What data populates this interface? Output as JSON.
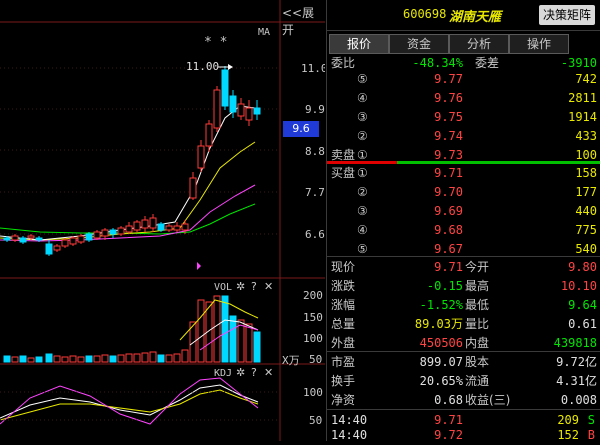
{
  "chart": {
    "expand_label": "<<展开",
    "ma_label": "MA",
    "peak_label": "11.00",
    "stars": "* *",
    "price_axis": [
      "11.0",
      "9.9",
      "8.8",
      "7.7",
      "6.6"
    ],
    "current_price_tag": "9.6",
    "vol_title": "VOL",
    "vol_axis": [
      "200",
      "150",
      "100",
      "50"
    ],
    "vol_unit": "X万",
    "kdj_title": "KDJ",
    "kdj_axis": [
      "100",
      "50"
    ],
    "colors": {
      "up": "#ff3a3a",
      "down": "#00d8ff",
      "ma5": "#ffffff",
      "ma10": "#e8e800",
      "ma20": "#ff44ff",
      "ma60": "#00e600"
    }
  },
  "header": {
    "code": "600698",
    "name": "湖南天雁",
    "decision_button": "决策矩阵"
  },
  "tabs": [
    {
      "label": "报价",
      "active": true
    },
    {
      "label": "资金",
      "active": false
    },
    {
      "label": "分析",
      "active": false
    },
    {
      "label": "操作",
      "active": false
    }
  ],
  "ratio": {
    "weibi_label": "委比",
    "weibi_value": "-48.34%",
    "weicha_label": "委差",
    "weicha_value": "-3910"
  },
  "sell_orders": [
    {
      "label": "",
      "level": "⑤",
      "price": "9.77",
      "volume": "742"
    },
    {
      "label": "",
      "level": "④",
      "price": "9.76",
      "volume": "2811"
    },
    {
      "label": "",
      "level": "③",
      "price": "9.75",
      "volume": "1914"
    },
    {
      "label": "",
      "level": "②",
      "price": "9.74",
      "volume": "433"
    },
    {
      "label": "卖盘",
      "level": "①",
      "price": "9.73",
      "volume": "100"
    }
  ],
  "buy_orders": [
    {
      "label": "买盘",
      "level": "①",
      "price": "9.71",
      "volume": "158"
    },
    {
      "label": "",
      "level": "②",
      "price": "9.70",
      "volume": "177"
    },
    {
      "label": "",
      "level": "③",
      "price": "9.69",
      "volume": "440"
    },
    {
      "label": "",
      "level": "④",
      "price": "9.68",
      "volume": "775"
    },
    {
      "label": "",
      "level": "⑤",
      "price": "9.67",
      "volume": "540"
    }
  ],
  "quote": [
    {
      "l1": "现价",
      "v1": "9.71",
      "c1": "red",
      "l2": "今开",
      "v2": "9.80",
      "c2": "red"
    },
    {
      "l1": "涨跌",
      "v1": "-0.15",
      "c1": "green",
      "l2": "最高",
      "v2": "10.10",
      "c2": "red"
    },
    {
      "l1": "涨幅",
      "v1": "-1.52%",
      "c1": "green",
      "l2": "最低",
      "v2": "9.64",
      "c2": "green"
    },
    {
      "l1": "总量",
      "v1": "89.03万",
      "c1": "yellow",
      "l2": "量比",
      "v2": "0.61",
      "c2": "white"
    },
    {
      "l1": "外盘",
      "v1": "450506",
      "c1": "red",
      "l2": "内盘",
      "v2": "439818",
      "c2": "green"
    }
  ],
  "stats": [
    {
      "l1": "市盈",
      "v1": "899.07",
      "l2": "股本",
      "v2": "9.72亿"
    },
    {
      "l1": "换手",
      "v1": "20.65%",
      "l2": "流通",
      "v2": "4.31亿"
    },
    {
      "l1": "净资",
      "v1": "0.68",
      "l2": "收益(三)",
      "v2": "0.008"
    }
  ],
  "ticks": [
    {
      "time": "14:40",
      "price": "9.71",
      "volume": "209",
      "side": "S",
      "side_color": "green"
    },
    {
      "time": "14:40",
      "price": "9.72",
      "volume": "152",
      "side": "B",
      "side_color": "red"
    }
  ]
}
